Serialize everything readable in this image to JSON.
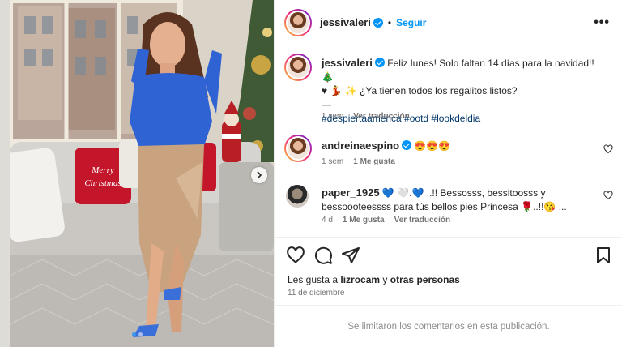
{
  "post": {
    "author": "jessivaleri",
    "follow_label": "Seguir",
    "more_label": "•••",
    "pillow_text": "Merry\nChristmas",
    "carousel": {
      "count": 2,
      "active_index": 0
    }
  },
  "caption": {
    "username": "jessivaleri",
    "line1": "Feliz lunes! Solo faltan 14 días para la navidad!! 🎄",
    "line2": "♥ 💃 ✨ ¿Ya tienen todos los regalitos listos?",
    "separator": "—",
    "hashtags": "#despiertaamerica #ootd #lookdeldia",
    "time": "1 sem",
    "translate": "Ver traducción"
  },
  "comments": [
    {
      "username": "andreinaespino",
      "text": "😍😍😍",
      "time": "1 sem",
      "likes": "1 Me gusta"
    },
    {
      "username": "paper_1925",
      "line1": "💙 🤍.💙 ..!! Bessosss, bessitoosss y",
      "line2": "bessoooteessss para tús bellos pies Princesa 🌹..!!😘 ...",
      "time": "4 d",
      "likes": "1 Me gusta",
      "translate": "Ver traducción"
    }
  ],
  "footer": {
    "likes_prefix": "Les gusta a",
    "liker": "lizrocam",
    "likes_joiner": "y",
    "likes_others": "otras personas",
    "date": "11 de diciembre",
    "comments_limited": "Se limitaron los comentarios en esta publicación."
  },
  "icons": {
    "like": "heart-icon",
    "comment": "comment-icon",
    "share": "share-icon",
    "save": "bookmark-icon"
  },
  "colors": {
    "accent": "#0095f6",
    "verified": "#0095f6",
    "hashtag": "#00376b",
    "muted": "#737373"
  }
}
